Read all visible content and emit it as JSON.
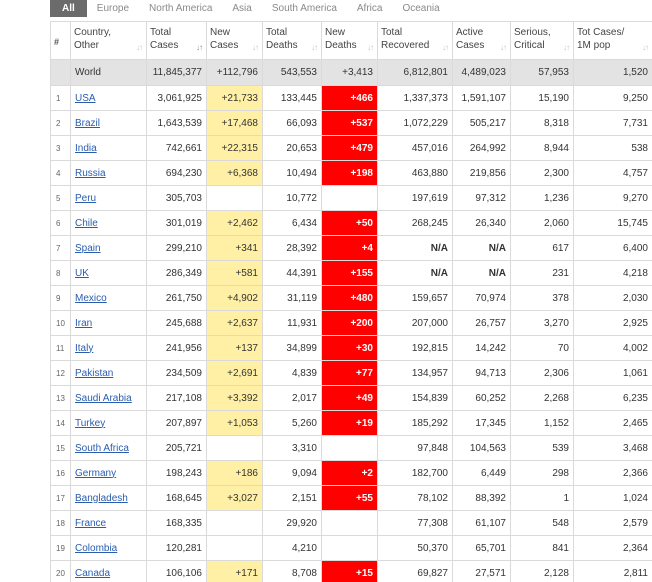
{
  "tabs": [
    "All",
    "Europe",
    "North America",
    "Asia",
    "South America",
    "Africa",
    "Oceania"
  ],
  "active_tab": 0,
  "columns": [
    {
      "key": "num",
      "line1": "#",
      "line2": ""
    },
    {
      "key": "country",
      "line1": "Country,",
      "line2": "Other"
    },
    {
      "key": "total_cases",
      "line1": "Total",
      "line2": "Cases"
    },
    {
      "key": "new_cases",
      "line1": "New",
      "line2": "Cases"
    },
    {
      "key": "total_deaths",
      "line1": "Total",
      "line2": "Deaths"
    },
    {
      "key": "new_deaths",
      "line1": "New",
      "line2": "Deaths"
    },
    {
      "key": "total_recovered",
      "line1": "Total",
      "line2": "Recovered"
    },
    {
      "key": "active_cases",
      "line1": "Active",
      "line2": "Cases"
    },
    {
      "key": "serious_critical",
      "line1": "Serious,",
      "line2": "Critical"
    },
    {
      "key": "tot_cases_1m",
      "line1": "Tot Cases/",
      "line2": "1M pop"
    }
  ],
  "world": {
    "country": "World",
    "total_cases": "11,845,377",
    "new_cases": "+112,796",
    "total_deaths": "543,553",
    "new_deaths": "+3,413",
    "total_recovered": "6,812,801",
    "active_cases": "4,489,023",
    "serious_critical": "57,953",
    "tot_cases_1m": "1,520"
  },
  "rows": [
    {
      "num": "1",
      "country": "USA",
      "total_cases": "3,061,925",
      "new_cases": "+21,733",
      "total_deaths": "133,445",
      "new_deaths": "+466",
      "total_recovered": "1,337,373",
      "active_cases": "1,591,107",
      "serious_critical": "15,190",
      "tot_cases_1m": "9,250"
    },
    {
      "num": "2",
      "country": "Brazil",
      "total_cases": "1,643,539",
      "new_cases": "+17,468",
      "total_deaths": "66,093",
      "new_deaths": "+537",
      "total_recovered": "1,072,229",
      "active_cases": "505,217",
      "serious_critical": "8,318",
      "tot_cases_1m": "7,731"
    },
    {
      "num": "3",
      "country": "India",
      "total_cases": "742,661",
      "new_cases": "+22,315",
      "total_deaths": "20,653",
      "new_deaths": "+479",
      "total_recovered": "457,016",
      "active_cases": "264,992",
      "serious_critical": "8,944",
      "tot_cases_1m": "538"
    },
    {
      "num": "4",
      "country": "Russia",
      "total_cases": "694,230",
      "new_cases": "+6,368",
      "total_deaths": "10,494",
      "new_deaths": "+198",
      "total_recovered": "463,880",
      "active_cases": "219,856",
      "serious_critical": "2,300",
      "tot_cases_1m": "4,757"
    },
    {
      "num": "5",
      "country": "Peru",
      "total_cases": "305,703",
      "new_cases": "",
      "total_deaths": "10,772",
      "new_deaths": "",
      "total_recovered": "197,619",
      "active_cases": "97,312",
      "serious_critical": "1,236",
      "tot_cases_1m": "9,270"
    },
    {
      "num": "6",
      "country": "Chile",
      "total_cases": "301,019",
      "new_cases": "+2,462",
      "total_deaths": "6,434",
      "new_deaths": "+50",
      "total_recovered": "268,245",
      "active_cases": "26,340",
      "serious_critical": "2,060",
      "tot_cases_1m": "15,745"
    },
    {
      "num": "7",
      "country": "Spain",
      "total_cases": "299,210",
      "new_cases": "+341",
      "total_deaths": "28,392",
      "new_deaths": "+4",
      "total_recovered": "N/A",
      "active_cases": "N/A",
      "serious_critical": "617",
      "tot_cases_1m": "6,400"
    },
    {
      "num": "8",
      "country": "UK",
      "total_cases": "286,349",
      "new_cases": "+581",
      "total_deaths": "44,391",
      "new_deaths": "+155",
      "total_recovered": "N/A",
      "active_cases": "N/A",
      "serious_critical": "231",
      "tot_cases_1m": "4,218"
    },
    {
      "num": "9",
      "country": "Mexico",
      "total_cases": "261,750",
      "new_cases": "+4,902",
      "total_deaths": "31,119",
      "new_deaths": "+480",
      "total_recovered": "159,657",
      "active_cases": "70,974",
      "serious_critical": "378",
      "tot_cases_1m": "2,030"
    },
    {
      "num": "10",
      "country": "Iran",
      "total_cases": "245,688",
      "new_cases": "+2,637",
      "total_deaths": "11,931",
      "new_deaths": "+200",
      "total_recovered": "207,000",
      "active_cases": "26,757",
      "serious_critical": "3,270",
      "tot_cases_1m": "2,925"
    },
    {
      "num": "11",
      "country": "Italy",
      "total_cases": "241,956",
      "new_cases": "+137",
      "total_deaths": "34,899",
      "new_deaths": "+30",
      "total_recovered": "192,815",
      "active_cases": "14,242",
      "serious_critical": "70",
      "tot_cases_1m": "4,002"
    },
    {
      "num": "12",
      "country": "Pakistan",
      "total_cases": "234,509",
      "new_cases": "+2,691",
      "total_deaths": "4,839",
      "new_deaths": "+77",
      "total_recovered": "134,957",
      "active_cases": "94,713",
      "serious_critical": "2,306",
      "tot_cases_1m": "1,061"
    },
    {
      "num": "13",
      "country": "Saudi Arabia",
      "total_cases": "217,108",
      "new_cases": "+3,392",
      "total_deaths": "2,017",
      "new_deaths": "+49",
      "total_recovered": "154,839",
      "active_cases": "60,252",
      "serious_critical": "2,268",
      "tot_cases_1m": "6,235"
    },
    {
      "num": "14",
      "country": "Turkey",
      "total_cases": "207,897",
      "new_cases": "+1,053",
      "total_deaths": "5,260",
      "new_deaths": "+19",
      "total_recovered": "185,292",
      "active_cases": "17,345",
      "serious_critical": "1,152",
      "tot_cases_1m": "2,465"
    },
    {
      "num": "15",
      "country": "South Africa",
      "total_cases": "205,721",
      "new_cases": "",
      "total_deaths": "3,310",
      "new_deaths": "",
      "total_recovered": "97,848",
      "active_cases": "104,563",
      "serious_critical": "539",
      "tot_cases_1m": "3,468"
    },
    {
      "num": "16",
      "country": "Germany",
      "total_cases": "198,243",
      "new_cases": "+186",
      "total_deaths": "9,094",
      "new_deaths": "+2",
      "total_recovered": "182,700",
      "active_cases": "6,449",
      "serious_critical": "298",
      "tot_cases_1m": "2,366"
    },
    {
      "num": "17",
      "country": "Bangladesh",
      "total_cases": "168,645",
      "new_cases": "+3,027",
      "total_deaths": "2,151",
      "new_deaths": "+55",
      "total_recovered": "78,102",
      "active_cases": "88,392",
      "serious_critical": "1",
      "tot_cases_1m": "1,024"
    },
    {
      "num": "18",
      "country": "France",
      "total_cases": "168,335",
      "new_cases": "",
      "total_deaths": "29,920",
      "new_deaths": "",
      "total_recovered": "77,308",
      "active_cases": "61,107",
      "serious_critical": "548",
      "tot_cases_1m": "2,579"
    },
    {
      "num": "19",
      "country": "Colombia",
      "total_cases": "120,281",
      "new_cases": "",
      "total_deaths": "4,210",
      "new_deaths": "",
      "total_recovered": "50,370",
      "active_cases": "65,701",
      "serious_critical": "841",
      "tot_cases_1m": "2,364"
    },
    {
      "num": "20",
      "country": "Canada",
      "total_cases": "106,106",
      "new_cases": "+171",
      "total_deaths": "8,708",
      "new_deaths": "+15",
      "total_recovered": "69,827",
      "active_cases": "27,571",
      "serious_critical": "2,128",
      "tot_cases_1m": "2,811"
    }
  ],
  "colors": {
    "tab_active_bg": "#6b6b6b",
    "new_cases_bg": "#fff0a6",
    "new_deaths_bg": "#ff0000",
    "world_row_bg": "#e3e3e3",
    "link": "#2a5db0"
  },
  "icons": {
    "sort": "sort-arrows-icon"
  }
}
